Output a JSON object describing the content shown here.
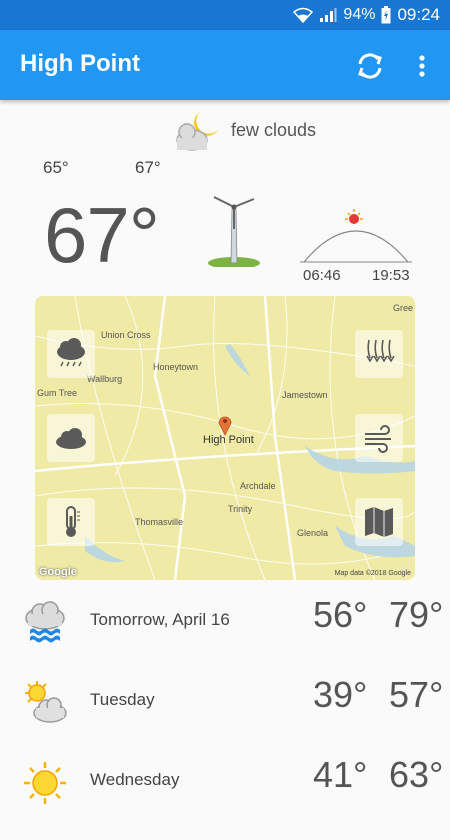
{
  "status": {
    "battery": "94%",
    "time": "09:24"
  },
  "header": {
    "title": "High Point"
  },
  "current": {
    "condition": "few clouds",
    "low": "65°",
    "high": "67°",
    "temp": "67°",
    "sunrise": "06:46",
    "sunset": "19:53"
  },
  "map": {
    "labels": {
      "union_cross": "Union Cross",
      "honeytown": "Honeytown",
      "wallburg": "Wallburg",
      "gum_tree": "Gum Tree",
      "jamestown": "Jamestown",
      "high_point": "High Point",
      "archdale": "Archdale",
      "trinity": "Trinity",
      "thomasville": "Thomasville",
      "glenola": "Glenola",
      "gree": "Gree"
    },
    "google": "Google",
    "attribution": "Map data ©2018 Google",
    "buttons": [
      "rain-radar",
      "clouds",
      "temperature",
      "precipitation",
      "wind",
      "map-layers"
    ]
  },
  "forecast": [
    {
      "day": "Tomorrow, April 16",
      "low": "56°",
      "high": "79°",
      "icon": "rain-cloud-icon"
    },
    {
      "day": "Tuesday",
      "low": "39°",
      "high": "57°",
      "icon": "sun-cloud-icon"
    },
    {
      "day": "Wednesday",
      "low": "41°",
      "high": "63°",
      "icon": "sun-icon"
    }
  ],
  "colors": {
    "primary": "#2196f3",
    "statusbar": "#1976d2",
    "map": "#eee8a6"
  }
}
